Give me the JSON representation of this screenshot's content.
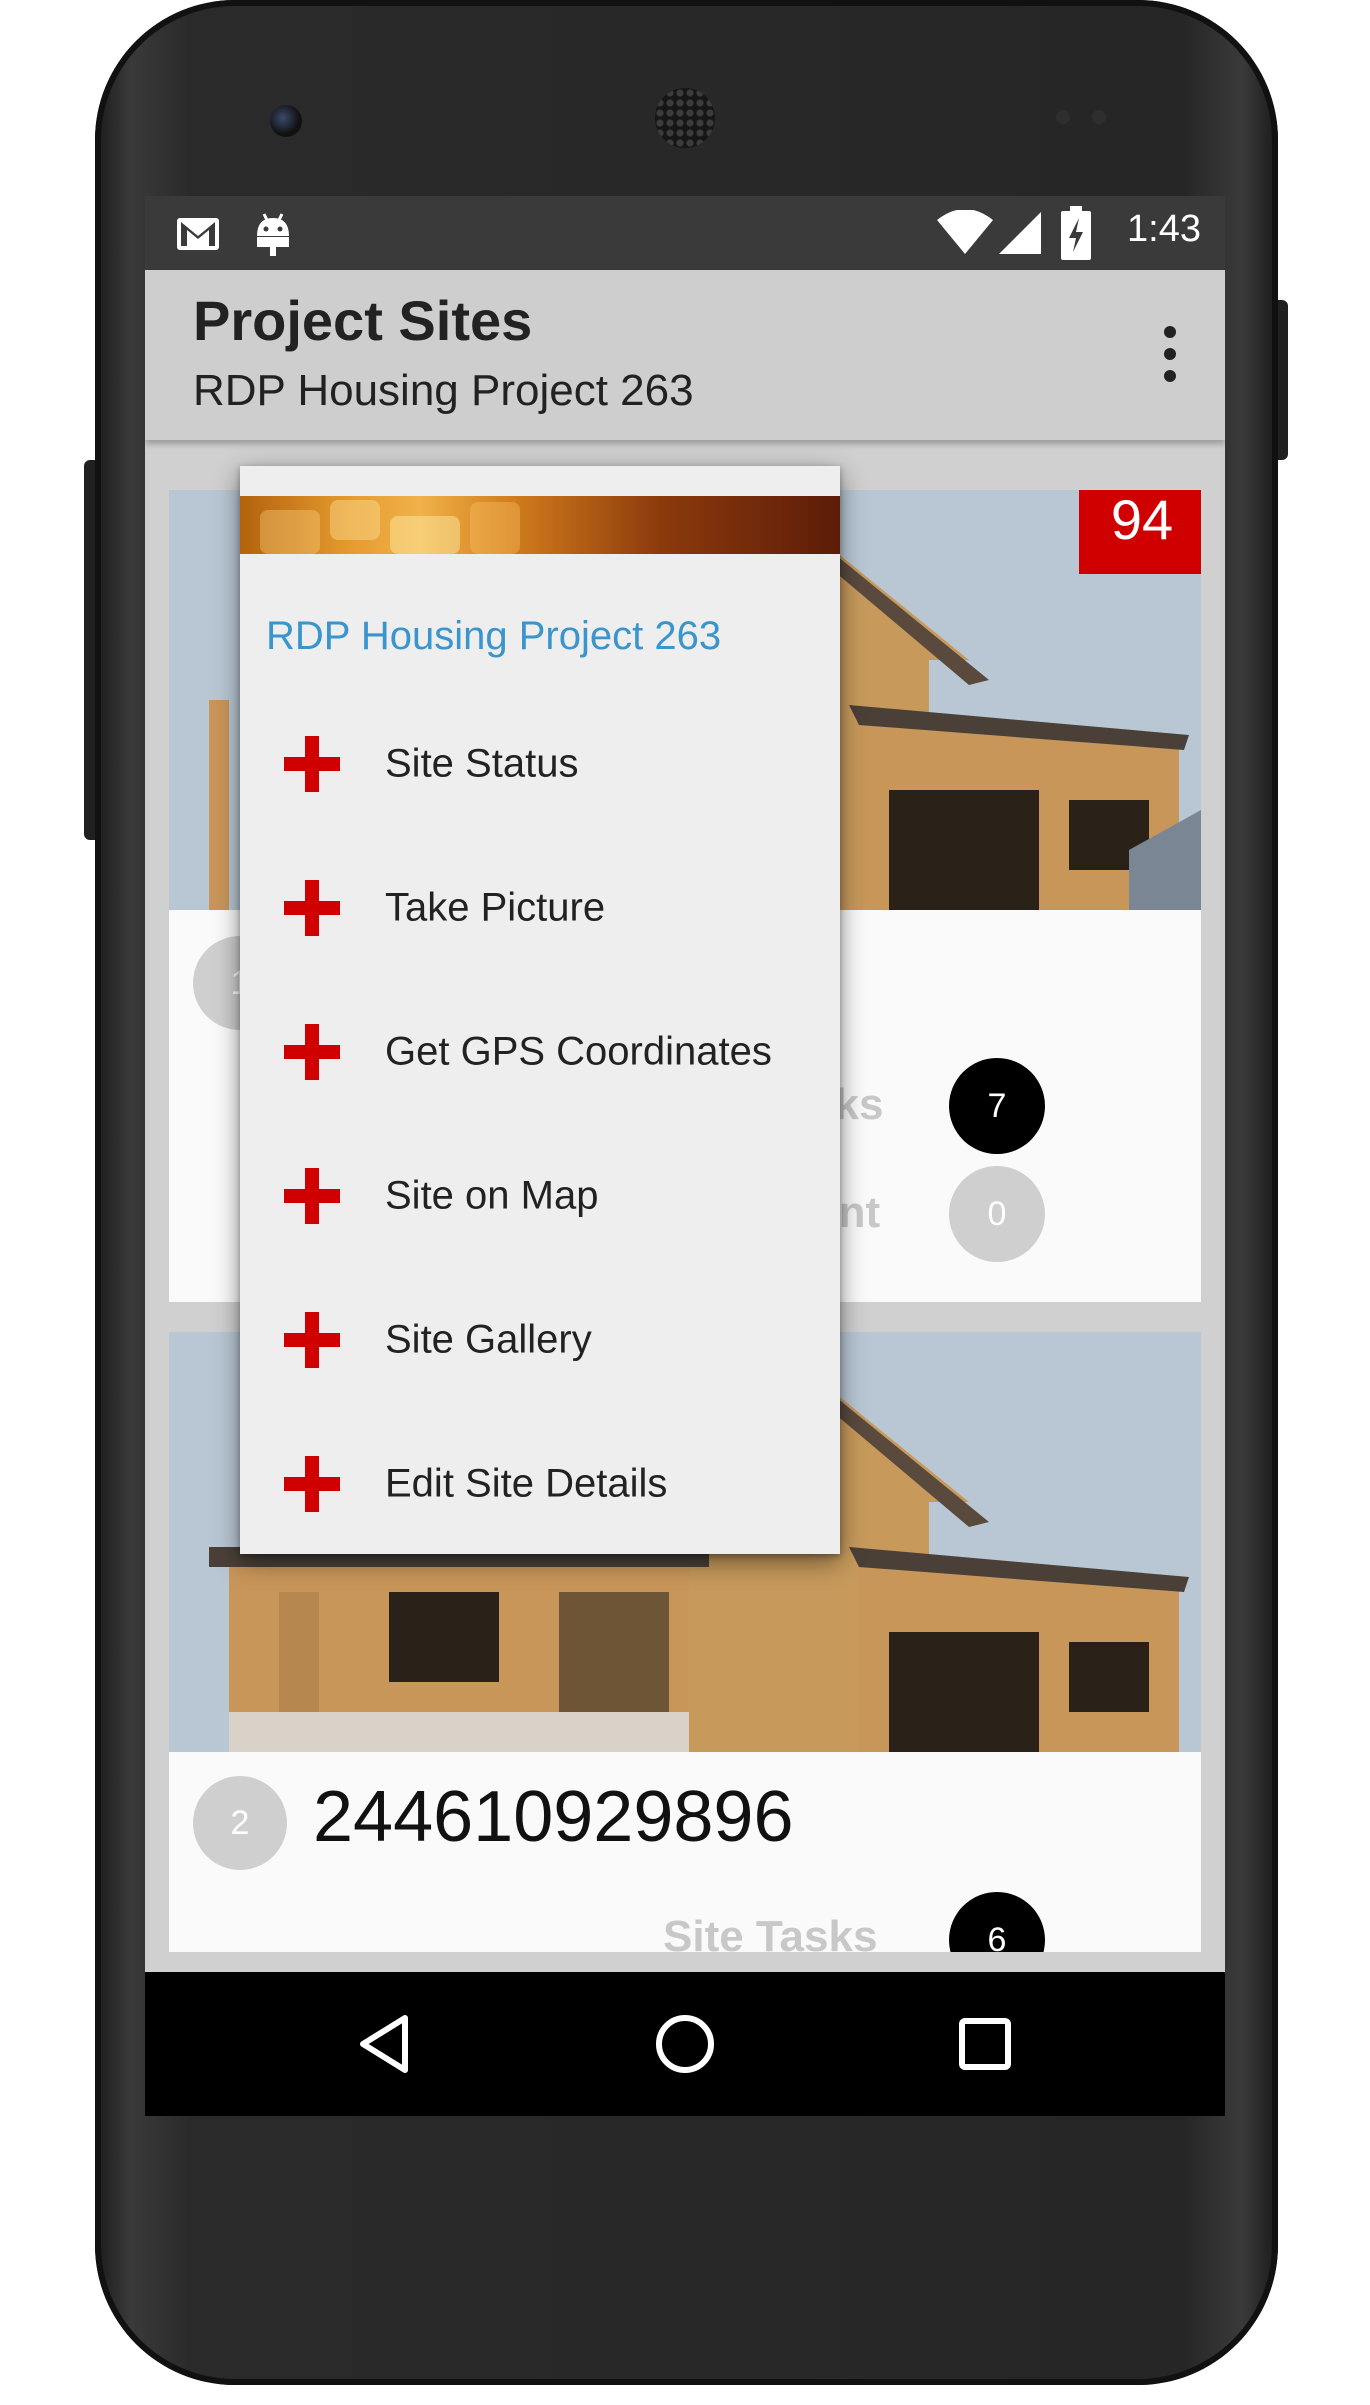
{
  "status_bar": {
    "time": "1:43",
    "icons": [
      "gmail-icon",
      "android-icon",
      "wifi-icon",
      "signal-icon",
      "battery-charging-icon"
    ]
  },
  "app_bar": {
    "title": "Project Sites",
    "subtitle": "RDP Housing Project 263",
    "overflow_icon": "more-vert-icon"
  },
  "cards": [
    {
      "badge": "94",
      "index": "1",
      "site_number": "",
      "site_tasks_label": "Site Tasks",
      "site_tasks_count": "7",
      "second_label": "Amount",
      "second_count": "0"
    },
    {
      "badge": "",
      "index": "2",
      "site_number": "244610929896",
      "site_tasks_label": "Site Tasks",
      "site_tasks_count": "6"
    }
  ],
  "popup_menu": {
    "title": "RDP Housing Project 263",
    "item_icon": "red-plus-icon",
    "items": [
      {
        "label": "Site Status"
      },
      {
        "label": "Take Picture"
      },
      {
        "label": "Get GPS Coordinates"
      },
      {
        "label": "Site on Map"
      },
      {
        "label": "Site Gallery"
      },
      {
        "label": "Edit Site Details"
      }
    ]
  },
  "nav_bar": {
    "icons": [
      "back-icon",
      "home-icon",
      "recents-icon"
    ]
  },
  "colors": {
    "accent_red": "#d10000",
    "popup_title_blue": "#3a95cc",
    "status_bar": "#3a3a3a",
    "app_bar": "#cecece"
  }
}
